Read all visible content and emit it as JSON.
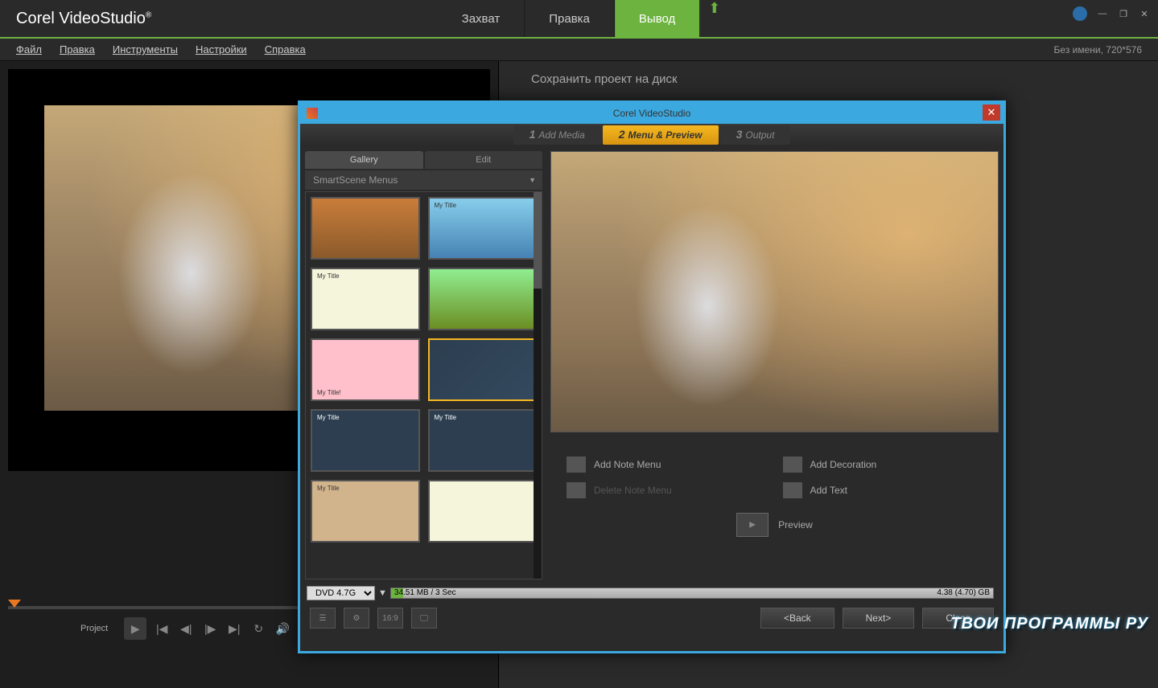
{
  "app": {
    "logo_corel": "Corel",
    "logo_video": " Video",
    "logo_studio": "Studio"
  },
  "main_tabs": {
    "capture": "Захват",
    "edit": "Правка",
    "output": "Вывод"
  },
  "menubar": {
    "file": "Файл",
    "edit": "Правка",
    "tools": "Инструменты",
    "settings": "Настройки",
    "help": "Справка",
    "status": "Без имени, 720*576"
  },
  "preview": {
    "project_label": "Project"
  },
  "right_header": "Сохранить проект на диск",
  "dialog": {
    "title": "Corel VideoStudio",
    "steps": {
      "s1_num": "1",
      "s1": "Add Media",
      "s2_num": "2",
      "s2": "Menu & Preview",
      "s3_num": "3",
      "s3": "Output"
    },
    "gallery_tab": "Gallery",
    "edit_tab": "Edit",
    "dropdown": "SmartScene Menus",
    "thumb_labels": {
      "t2": "My Title",
      "t3": "My Title",
      "t5": "My Title!",
      "t7": "My Title",
      "t8": "My Title",
      "t9": "My Title"
    },
    "actions": {
      "add_note": "Add Note Menu",
      "delete_note": "Delete Note Menu",
      "add_decoration": "Add Decoration",
      "add_text": "Add Text",
      "preview": "Preview"
    },
    "status": {
      "disc": "DVD 4.7G",
      "used": "34.51 MB / 3 Sec",
      "total": "4.38 (4.70) GB"
    },
    "footer": {
      "aspect": "16:9",
      "back": "<Back",
      "next": "Next>",
      "close": "Close"
    }
  },
  "watermark": "ТВОИ ПРОГРАММЫ РУ"
}
